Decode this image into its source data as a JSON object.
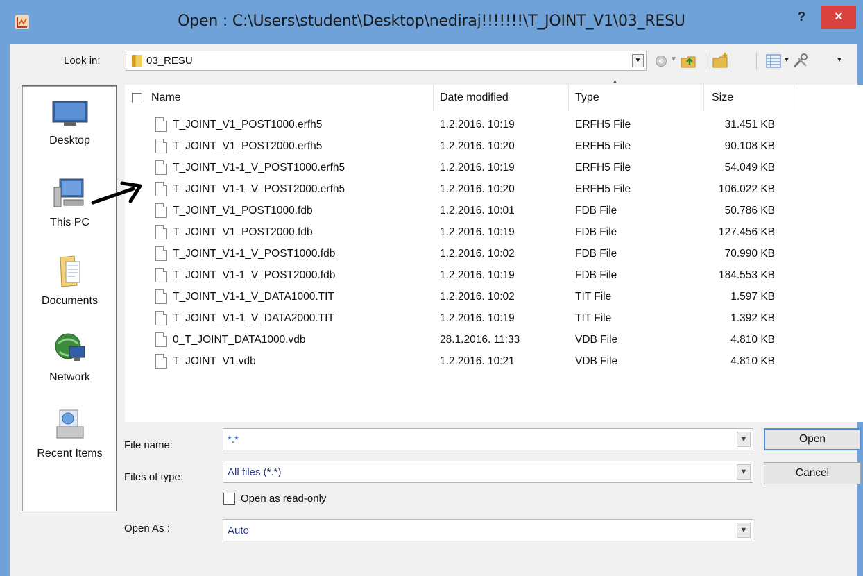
{
  "window": {
    "title": "Open : C:\\Users\\student\\Desktop\\nediraj!!!!!!!\\T_JOINT_V1\\03_RESU",
    "help_label": "?",
    "close_label": "×"
  },
  "lookin": {
    "label": "Look in:",
    "value": "03_RESU",
    "arrow": "▼"
  },
  "toolbar": {
    "icons": [
      "back-icon",
      "up-folder-icon",
      "new-folder-icon",
      "view-menu-icon",
      "tools-icon"
    ]
  },
  "places": [
    {
      "label": "Desktop",
      "icon": "desktop-icon"
    },
    {
      "label": "This PC",
      "icon": "computer-icon"
    },
    {
      "label": "Documents",
      "icon": "documents-icon"
    },
    {
      "label": "Network",
      "icon": "network-icon"
    },
    {
      "label": "Recent Items",
      "icon": "recent-items-icon"
    }
  ],
  "columns": {
    "name": "Name",
    "date": "Date modified",
    "type": "Type",
    "size": "Size"
  },
  "files": [
    {
      "name": "T_JOINT_V1_POST1000.erfh5",
      "date": "1.2.2016. 10:19",
      "type": "ERFH5 File",
      "size": "31.451 KB"
    },
    {
      "name": "T_JOINT_V1_POST2000.erfh5",
      "date": "1.2.2016. 10:20",
      "type": "ERFH5 File",
      "size": "90.108 KB"
    },
    {
      "name": "T_JOINT_V1-1_V_POST1000.erfh5",
      "date": "1.2.2016. 10:19",
      "type": "ERFH5 File",
      "size": "54.049 KB"
    },
    {
      "name": "T_JOINT_V1-1_V_POST2000.erfh5",
      "date": "1.2.2016. 10:20",
      "type": "ERFH5 File",
      "size": "106.022 KB"
    },
    {
      "name": "T_JOINT_V1_POST1000.fdb",
      "date": "1.2.2016. 10:01",
      "type": "FDB File",
      "size": "50.786 KB"
    },
    {
      "name": "T_JOINT_V1_POST2000.fdb",
      "date": "1.2.2016. 10:19",
      "type": "FDB File",
      "size": "127.456 KB"
    },
    {
      "name": "T_JOINT_V1-1_V_POST1000.fdb",
      "date": "1.2.2016. 10:02",
      "type": "FDB File",
      "size": "70.990 KB"
    },
    {
      "name": "T_JOINT_V1-1_V_POST2000.fdb",
      "date": "1.2.2016. 10:19",
      "type": "FDB File",
      "size": "184.553 KB"
    },
    {
      "name": "T_JOINT_V1-1_V_DATA1000.TIT",
      "date": "1.2.2016. 10:02",
      "type": "TIT File",
      "size": "1.597 KB"
    },
    {
      "name": "T_JOINT_V1-1_V_DATA2000.TIT",
      "date": "1.2.2016. 10:19",
      "type": "TIT File",
      "size": "1.392 KB"
    },
    {
      "name": "0_T_JOINT_DATA1000.vdb",
      "date": "28.1.2016. 11:33",
      "type": "VDB File",
      "size": "4.810 KB"
    },
    {
      "name": "T_JOINT_V1.vdb",
      "date": "1.2.2016. 10:21",
      "type": "VDB File",
      "size": "4.810 KB"
    }
  ],
  "form": {
    "filename_label": "File name:",
    "filename_value": "*.*",
    "filetype_label": "Files of type:",
    "filetype_value": "All files (*.*)",
    "readonly_label": "Open as read-only",
    "openas_label": "Open As :",
    "openas_value": "Auto"
  },
  "buttons": {
    "open": "Open",
    "cancel": "Cancel"
  },
  "colors": {
    "frame": "#6ea2d9",
    "close": "#d9423e",
    "default_button_border": "#4f8ed6"
  }
}
